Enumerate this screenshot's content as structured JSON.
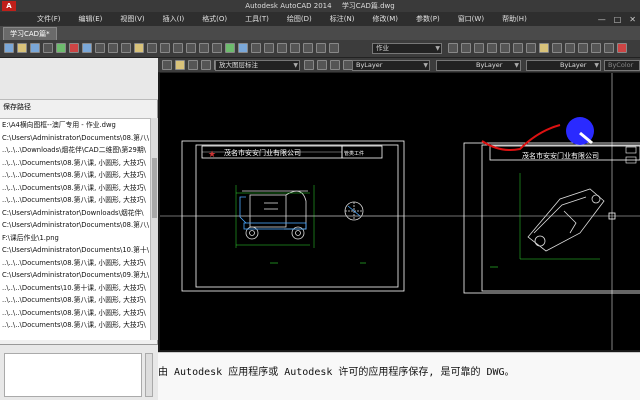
{
  "window": {
    "logo_text": "A",
    "app_title": "Autodesk AutoCAD 2014",
    "document_title": "学习CAD篇.dwg",
    "controls": [
      "—",
      "□",
      "✕"
    ]
  },
  "menu": {
    "items": [
      "文件(F)",
      "编辑(E)",
      "视图(V)",
      "插入(I)",
      "格式(O)",
      "工具(T)",
      "绘图(D)",
      "标注(N)",
      "修改(M)",
      "参数(P)",
      "窗口(W)",
      "帮助(H)"
    ]
  },
  "tabs": {
    "active": "学习CAD篇*"
  },
  "toolbar": {
    "workspace_combo": "作业",
    "layer_combo": "放大图层标注",
    "color_combo": "ByLayer",
    "linetype_combo": "ByLayer",
    "lineweight_combo": "ByLayer",
    "plotstyle_combo": "ByColor"
  },
  "left_panel": {
    "title": "保存路径",
    "paths": [
      "E:\\A4横向图框--澳厂专用 - 作业.dwg",
      "C:\\Users\\Administrator\\Documents\\08.第八\\",
      "..\\..\\..\\Downloads\\烟花伴\\CAD二维图\\第29期\\",
      "..\\..\\..\\Documents\\08.第八课, 小圆形, 大技巧\\",
      "..\\..\\..\\Documents\\08.第八课, 小圆形, 大技巧\\",
      "..\\..\\..\\Documents\\08.第八课, 小圆形, 大技巧\\",
      "..\\..\\..\\Documents\\08.第八课, 小圆形, 大技巧\\",
      "C:\\Users\\Administrator\\Downloads\\烟花伴\\",
      "C:\\Users\\Administrator\\Documents\\08.第八\\",
      "F:\\课后作业\\1.png",
      "C:\\Users\\Administrator\\Documents\\10.第十\\",
      "..\\..\\..\\Documents\\08.第八课, 小圆形, 大技巧\\",
      "C:\\Users\\Administrator\\Documents\\09.第九\\",
      "..\\..\\..\\Documents\\10.第十课, 小圆形, 大技巧\\",
      "..\\..\\..\\Documents\\08.第八课, 小圆形, 大技巧\\",
      "..\\..\\..\\Documents\\08.第八课, 小圆形, 大技巧\\",
      "..\\..\\..\\Documents\\08.第八课, 小圆形, 大技巧\\"
    ]
  },
  "drawing": {
    "company_left": "茂名市安安门业有限公司",
    "company_right": "茂名市安安门业有限公司",
    "small_label": "管类工件"
  },
  "message": {
    "text": "由 Autodesk 应用程序或 Autodesk 许可的应用程序保存, 是可靠的 DWG。"
  },
  "colors": {
    "canvas": "#000000",
    "frame_line": "#ffffff",
    "green_line": "#33dd33",
    "cursor_blue": "#2a2aff",
    "stroke_red": "#dd1111"
  }
}
